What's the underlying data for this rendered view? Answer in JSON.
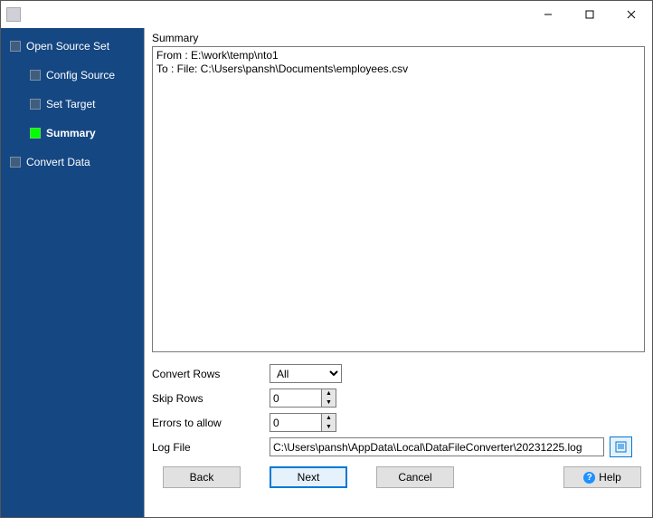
{
  "sidebar": {
    "items": [
      {
        "label": "Open Source Set",
        "indent": 0,
        "active": false
      },
      {
        "label": "Config Source",
        "indent": 1,
        "active": false
      },
      {
        "label": "Set Target",
        "indent": 1,
        "active": false
      },
      {
        "label": "Summary",
        "indent": 1,
        "active": true
      },
      {
        "label": "Convert Data",
        "indent": 0,
        "active": false
      }
    ]
  },
  "summary": {
    "title": "Summary",
    "from_line": "From : E:\\work\\temp\\nto1",
    "to_line": "To : File: C:\\Users\\pansh\\Documents\\employees.csv"
  },
  "form": {
    "convert_rows_label": "Convert Rows",
    "convert_rows_value": "All",
    "skip_rows_label": "Skip Rows",
    "skip_rows_value": "0",
    "errors_label": "Errors to allow",
    "errors_value": "0",
    "log_file_label": "Log File",
    "log_file_value": "C:\\Users\\pansh\\AppData\\Local\\DataFileConverter\\20231225.log"
  },
  "buttons": {
    "back": "Back",
    "next": "Next",
    "cancel": "Cancel",
    "help": "Help"
  }
}
